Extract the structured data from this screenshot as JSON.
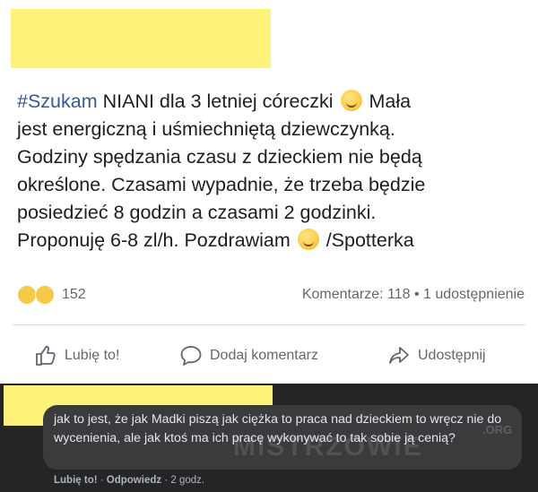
{
  "post": {
    "hashtag": "#Szukam",
    "text_line1": " NIANI dla  3 letniej córeczki",
    "text_after_emoji1": " Mała",
    "text_line2": "jest energiczną i uśmiechniętą dziewczynką.",
    "text_line3": "Godziny spędzania czasu z dzieckiem nie będą",
    "text_line4": "określone.  Czasami wypadnie, że trzeba będzie",
    "text_line5": "posiedzieć 8 godzin a czasami 2 godzinki.",
    "text_line6_a": "Proponuję 6-8 zl/h. Pozdrawiam",
    "text_line6_b": " /Spotterka",
    "emoji1": "smiling-face-emoji",
    "emoji2": "grinning-face-emoji"
  },
  "stats": {
    "reactions_count": "152",
    "comments": "Komentarze: 118",
    "separator": " • ",
    "shares": "1 udostępnienie"
  },
  "actions": {
    "like": "Lubię to!",
    "comment": "Dodaj komentarz",
    "share": "Udostępnij"
  },
  "comment": {
    "text": "jak to jest, że jak Madki piszą jak ciężka to praca nad dzieckiem to wręcz nie do wycenienia, ale jak ktoś ma ich pracę wykonywać to tak sobie ją cenią?",
    "like": "Lubię to!",
    "reply": "Odpowiedz",
    "time": "2 godz.",
    "dot": " · "
  },
  "watermark": {
    "main": "MISTRZOWIE",
    "suffix": ".ORG"
  },
  "colors": {
    "hashtag": "#385898",
    "redaction": "#fdf27a",
    "comment_bg": "#242526",
    "bubble_bg": "#3a3b3c"
  }
}
